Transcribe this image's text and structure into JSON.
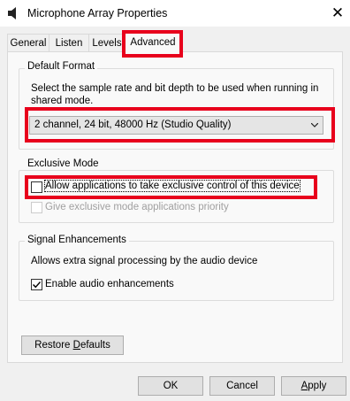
{
  "window": {
    "title": "Microphone Array Properties",
    "close_glyph": "✕",
    "icon": "speaker-icon"
  },
  "tabs": [
    {
      "label": "General",
      "active": false
    },
    {
      "label": "Listen",
      "active": false
    },
    {
      "label": "Levels",
      "active": false
    },
    {
      "label": "Advanced",
      "active": true
    }
  ],
  "default_format": {
    "legend": "Default Format",
    "description": "Select the sample rate and bit depth to be used when running in shared mode.",
    "selected_format": "2 channel, 24 bit, 48000 Hz (Studio Quality)"
  },
  "exclusive_mode": {
    "legend": "Exclusive Mode",
    "allow_control": {
      "label": "Allow applications to take exclusive control of this device",
      "checked": false
    },
    "give_priority": {
      "label": "Give exclusive mode applications priority",
      "checked": false,
      "enabled": false
    }
  },
  "signal_enhancements": {
    "legend": "Signal Enhancements",
    "description": "Allows extra signal processing by the audio device",
    "enable_enhancements": {
      "label": "Enable audio enhancements",
      "checked": true
    }
  },
  "restore_defaults": {
    "before": "Restore ",
    "mnemonic": "D",
    "after": "efaults"
  },
  "buttons": {
    "ok": "OK",
    "cancel": "Cancel",
    "apply_mnemonic": "A",
    "apply_rest": "pply"
  },
  "colors": {
    "highlight": "#e8001c",
    "default_button_border": "#0078d7",
    "window_bg": "#f0f0f0"
  }
}
